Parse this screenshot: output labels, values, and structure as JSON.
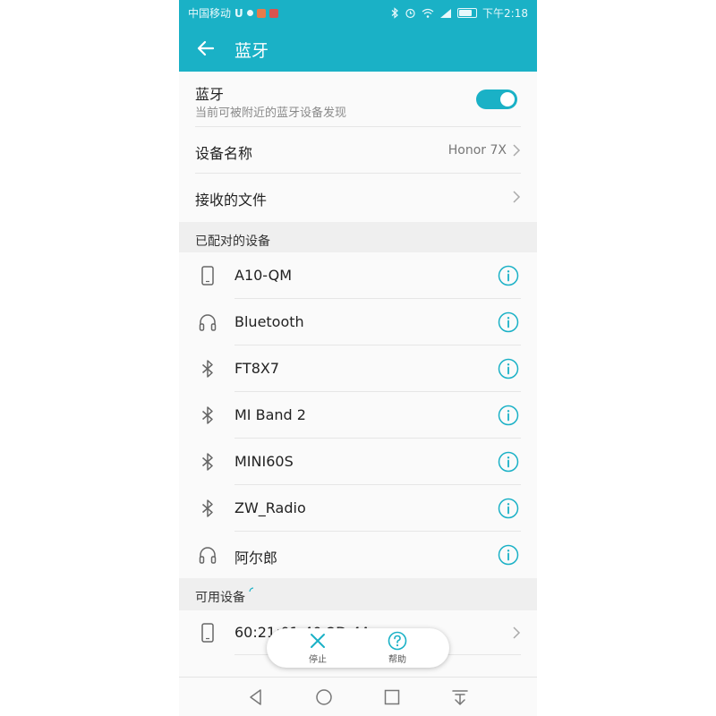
{
  "status_bar": {
    "carrier": "中国移动",
    "time": "下午2:18",
    "battery_level": 0.8,
    "icons": [
      "u-app-icon",
      "dot-icon",
      "app-icon-orange",
      "app-icon-red",
      "bluetooth-icon",
      "alarm-icon",
      "wifi-icon",
      "signal-icon",
      "battery-icon"
    ]
  },
  "header": {
    "title": "蓝牙"
  },
  "bluetooth_toggle": {
    "label": "蓝牙",
    "sublabel": "当前可被附近的蓝牙设备发现",
    "enabled": true
  },
  "device_name": {
    "label": "设备名称",
    "value": "Honor 7X"
  },
  "received_files": {
    "label": "接收的文件"
  },
  "paired": {
    "title": "已配对的设备",
    "devices": [
      {
        "name": "A10-QM",
        "icon": "phone-icon"
      },
      {
        "name": "Bluetooth",
        "icon": "headphones-icon"
      },
      {
        "name": "FT8X7",
        "icon": "bluetooth-icon"
      },
      {
        "name": "MI Band 2",
        "icon": "bluetooth-icon"
      },
      {
        "name": "MINI60S",
        "icon": "bluetooth-icon"
      },
      {
        "name": "ZW_Radio",
        "icon": "bluetooth-icon"
      },
      {
        "name": "阿尔郎",
        "icon": "headphones-icon"
      }
    ]
  },
  "available": {
    "title": "可用设备",
    "devices": [
      {
        "name": "60:21:01:40:2D:4A",
        "icon": "phone-icon"
      }
    ]
  },
  "bottom_actions": {
    "stop": "停止",
    "help": "帮助"
  },
  "colors": {
    "accent": "#1ab1c6"
  }
}
